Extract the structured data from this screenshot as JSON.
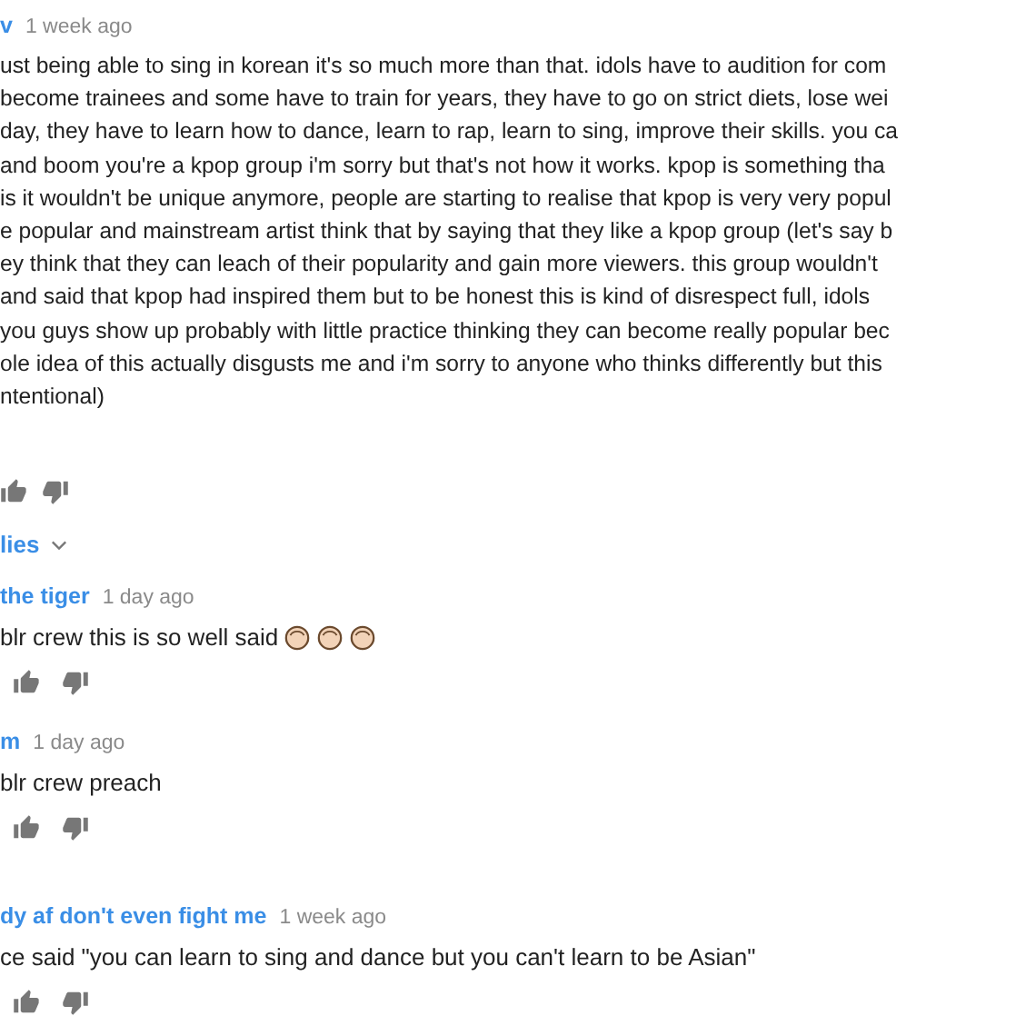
{
  "comment": {
    "author": "v",
    "time": "1 week ago",
    "lines": [
      "ust being able to sing in korean it's so much more than that. idols have to audition for com",
      "become trainees and some have to train for years, they have to go on strict diets, lose wei",
      "day, they have to learn how to dance, learn to rap, learn to sing, improve their skills. you ca",
      "and boom you're a kpop group i'm sorry but that's not how it works. kpop is something tha",
      "is it wouldn't be unique anymore, people are starting to realise that kpop is very very popul",
      "e popular and mainstream artist think that by saying that they like a kpop group (let's say b",
      "ey think that they can leach of their popularity and gain more viewers. this group wouldn't",
      "and said that kpop had inspired them but to be honest this is kind of disrespect full, idols",
      "you guys show up probably with little practice thinking they can become really popular bec",
      "ole idea of this actually disgusts me and i'm sorry to anyone who thinks differently but this",
      "ntentional)"
    ],
    "replies_toggle": "lies"
  },
  "replies": [
    {
      "author": "the tiger",
      "time": "1 day ago",
      "text": "blr crew this is so well said",
      "kind": "with-emoji"
    },
    {
      "author": "m",
      "time": "1 day ago",
      "text": "blr crew preach",
      "kind": "plain"
    },
    {
      "author": "dy af don't even fight me",
      "time": "1 week ago",
      "text": "ce said \"you can learn to sing and dance but you can't learn to be Asian\"",
      "kind": "plain"
    }
  ]
}
